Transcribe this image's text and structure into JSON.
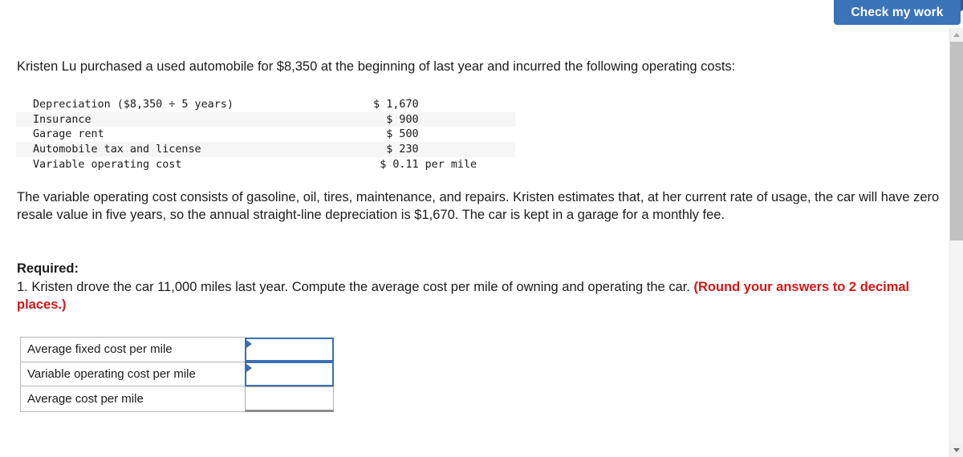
{
  "toolbar": {
    "check_my_work_label": "Check my work",
    "button_color": "#3b73b9",
    "badge_color": "#2a5a96"
  },
  "intro": {
    "text": "Kristen Lu purchased a used automobile for $8,350 at the beginning of last year and incurred the following operating costs:"
  },
  "cost_table": {
    "rows": [
      {
        "label": "Depreciation ($8,350 ÷ 5 years)",
        "amount": "$ 1,670",
        "suffix": "",
        "shaded": false
      },
      {
        "label": "Insurance",
        "amount": "$ 900",
        "suffix": "",
        "shaded": true
      },
      {
        "label": "Garage rent",
        "amount": "$ 500",
        "suffix": "",
        "shaded": false
      },
      {
        "label": "Automobile tax and license",
        "amount": "$ 230",
        "suffix": "",
        "shaded": true
      },
      {
        "label": "Variable operating cost",
        "amount": "$ 0.11",
        "suffix": "per mile",
        "shaded": false
      }
    ]
  },
  "paragraph": {
    "text": "The variable operating cost consists of gasoline, oil, tires, maintenance, and repairs. Kristen estimates that, at her current rate of usage, the car will have zero resale value in five years, so the annual straight-line depreciation is $1,670. The car is kept in a garage for a monthly fee."
  },
  "required": {
    "heading": "Required:",
    "question_main": "1. Kristen drove the car 11,000 miles last year. Compute the average cost per mile of owning and operating the car. ",
    "question_emphasis": "(Round your answers to 2 decimal places.)",
    "emphasis_color": "#d01919"
  },
  "answer_table": {
    "rows": [
      {
        "label": "Average fixed cost per mile",
        "value": "",
        "placeholder": "",
        "highlighted": true
      },
      {
        "label": "Variable operating cost per mile",
        "value": "",
        "placeholder": "",
        "highlighted": true
      },
      {
        "label": "Average cost per mile",
        "value": "",
        "placeholder": "",
        "highlighted": false
      }
    ]
  },
  "scrollbar": {
    "up_arrow": "scroll-up-arrow",
    "down_arrow": "scroll-down-arrow",
    "thumb_position": "near-top"
  }
}
